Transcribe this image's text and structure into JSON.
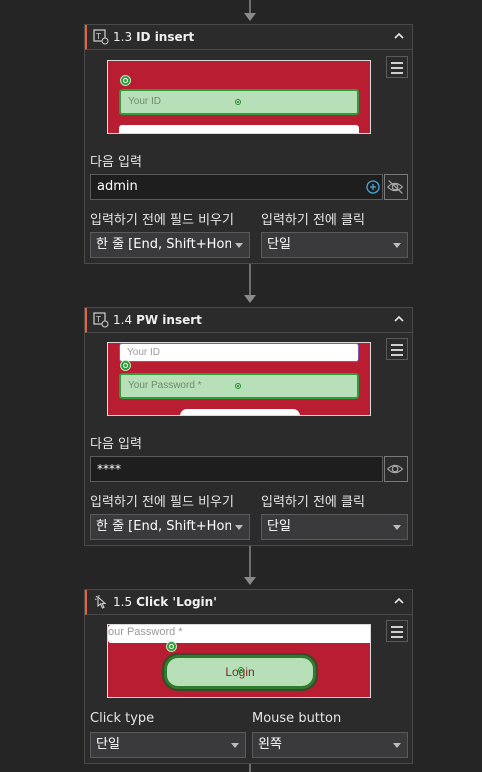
{
  "cards": [
    {
      "number": "1.3",
      "title": "ID insert",
      "icon": "text-input-icon",
      "preview": {
        "field_placeholder": "Your ID"
      },
      "next_input_label": "다음 입력",
      "next_input_value": "admin",
      "clear_label": "입력하기 전에 필드 비우기",
      "clear_value": "한 줄 [End, Shift+Home",
      "click_label": "입력하기 전에 클릭",
      "click_value": "단일"
    },
    {
      "number": "1.4",
      "title": "PW insert",
      "icon": "text-input-icon",
      "preview": {
        "top_placeholder": "Your ID",
        "field_placeholder": "Your Password *"
      },
      "next_input_label": "다음 입력",
      "next_input_value": "****",
      "clear_label": "입력하기 전에 필드 비우기",
      "clear_value": "한 줄 [End, Shift+Home",
      "click_label": "입력하기 전에 클릭",
      "click_value": "단일"
    },
    {
      "number": "1.5",
      "title": "Click 'Login'",
      "icon": "click-icon",
      "preview": {
        "top_placeholder": "our Password *",
        "button_label": "Login"
      },
      "click_type_label": "Click type",
      "click_type_value": "단일",
      "mouse_button_label": "Mouse button",
      "mouse_button_value": "왼쪽"
    }
  ],
  "colors": {
    "background": "#252526",
    "card": "#2b2b2c",
    "accent": "#e8633a",
    "preview_bg": "#b81d32",
    "highlight": "#b8e0b8",
    "highlight_border": "#2e9e3a"
  }
}
